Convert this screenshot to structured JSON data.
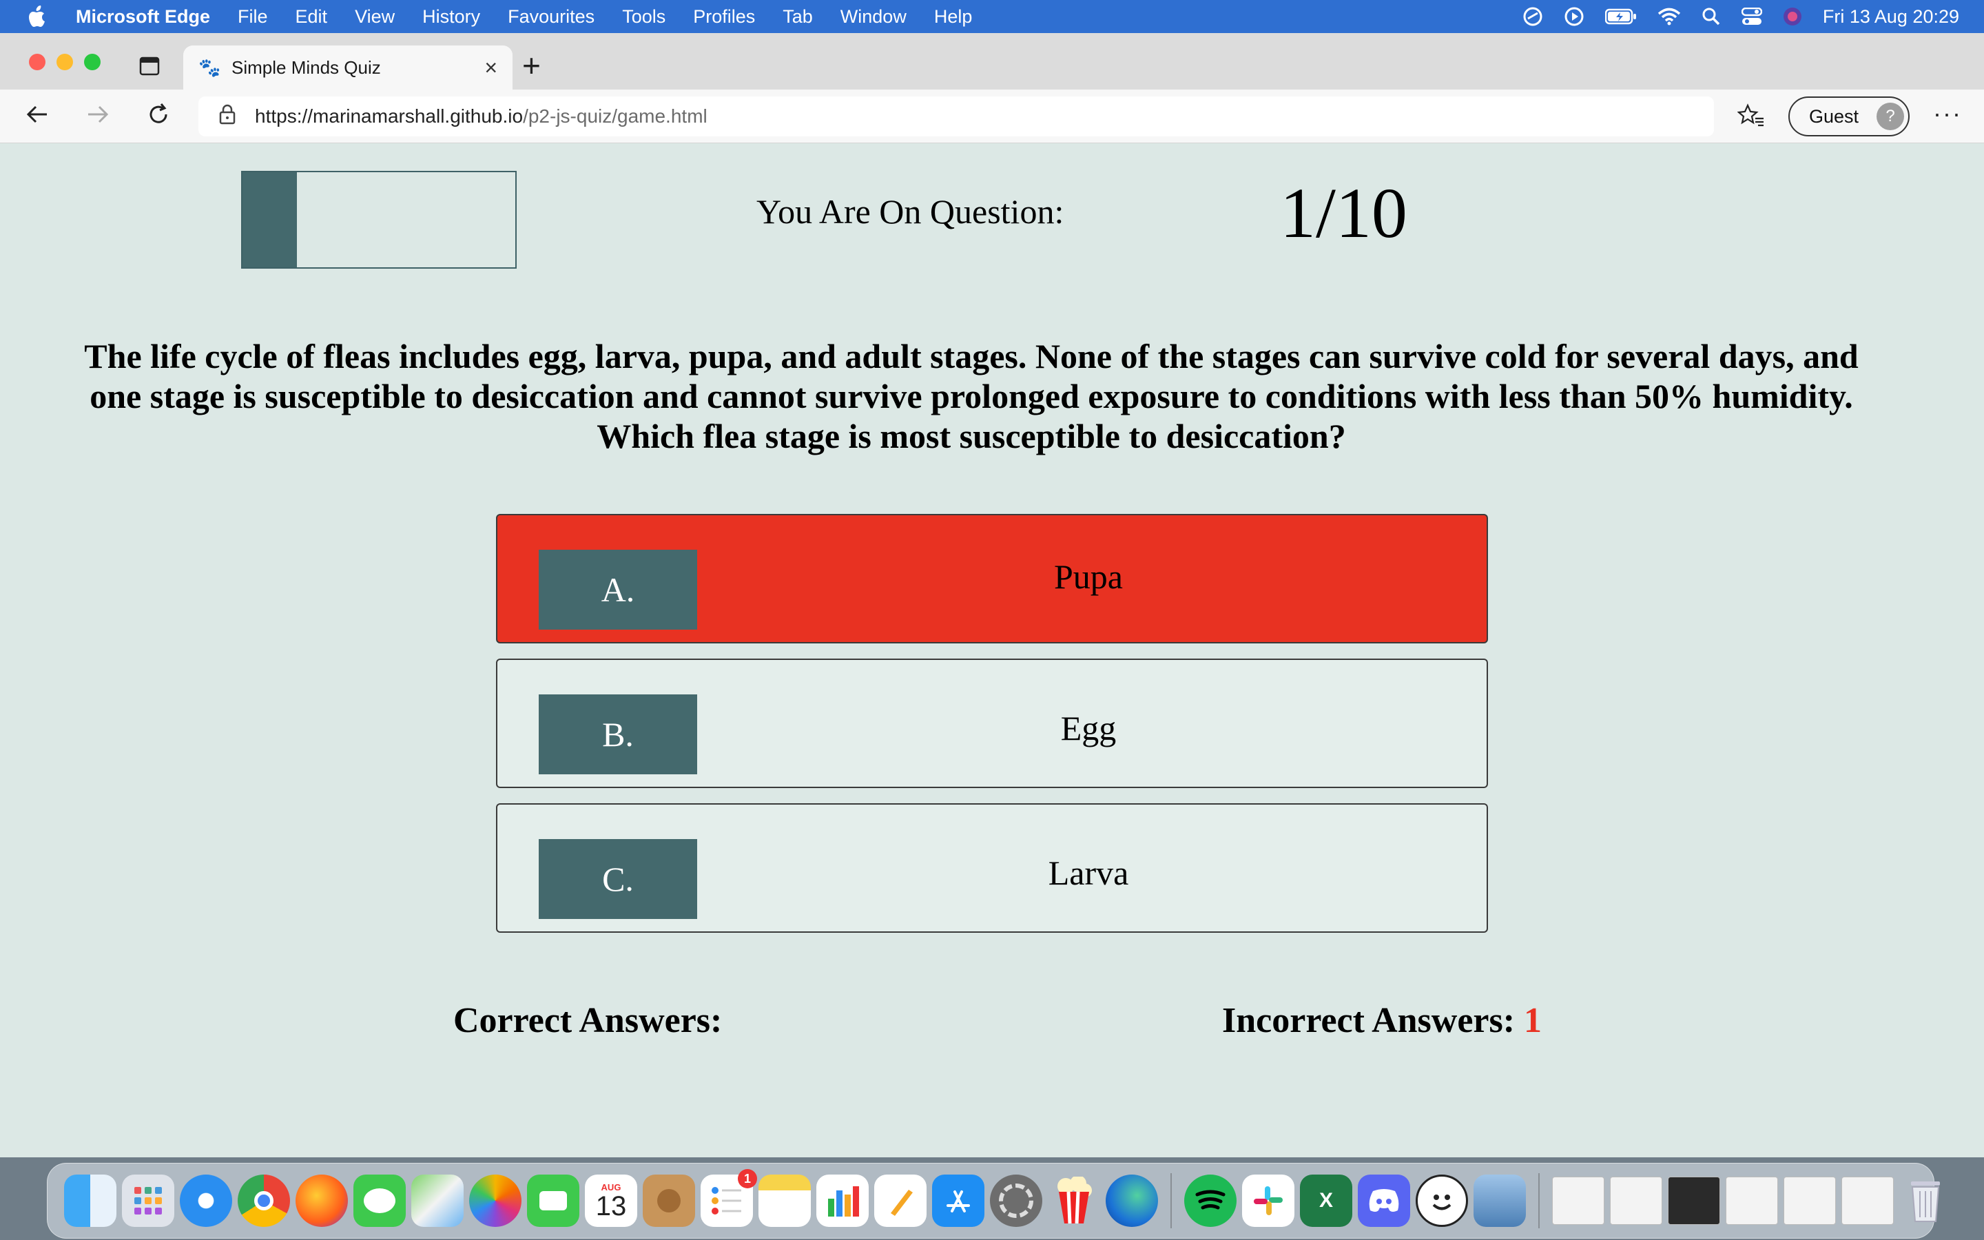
{
  "menubar": {
    "app_name": "Microsoft Edge",
    "items": [
      "File",
      "Edit",
      "View",
      "History",
      "Favourites",
      "Tools",
      "Profiles",
      "Tab",
      "Window",
      "Help"
    ],
    "datetime": "Fri 13 Aug  20:29"
  },
  "browser": {
    "tab_title": "Simple Minds Quiz",
    "url_host": "https://marinamarshall.github.io",
    "url_path": "/p2-js-quiz/game.html",
    "profile_label": "Guest"
  },
  "quiz": {
    "progress_fraction": 0.2,
    "question_label": "You Are On Question:",
    "question_counter": "1/10",
    "question_text": "The life cycle of fleas includes egg, larva, pupa, and adult stages. None of the stages can survive cold for several days, and one stage is susceptible to desiccation and cannot survive prolonged exposure to conditions with less than 50% humidity. Which flea stage is most susceptible to desiccation?",
    "answers": [
      {
        "prefix": "A.",
        "text": "Pupa",
        "state": "incorrect"
      },
      {
        "prefix": "B.",
        "text": "Egg",
        "state": "normal"
      },
      {
        "prefix": "C.",
        "text": "Larva",
        "state": "normal"
      }
    ],
    "correct_label": "Correct Answers:",
    "correct_value": "",
    "incorrect_label": "Incorrect Answers:",
    "incorrect_value": "1"
  },
  "colors": {
    "accent_teal": "#44696d",
    "incorrect_red": "#e83222",
    "page_bg": "#dce8e5"
  },
  "dock": {
    "calendar_month": "AUG",
    "calendar_day": "13",
    "reminders_badge": "1"
  }
}
